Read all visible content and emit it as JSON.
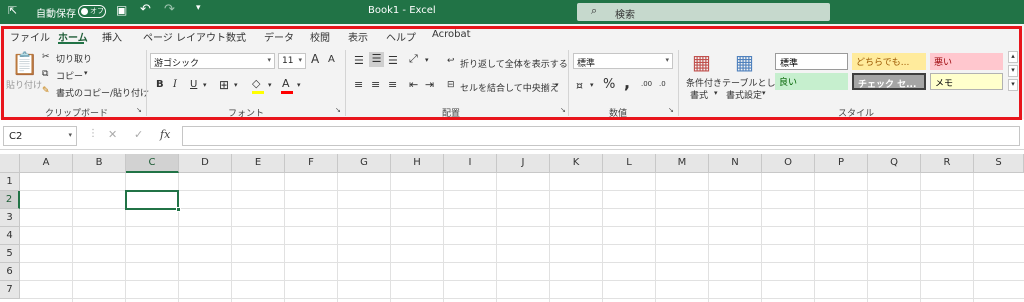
{
  "titlebar": {
    "autosave_label": "自動保存",
    "autosave_state": "オフ",
    "title": "Book1  -  Excel",
    "search_placeholder": "検索",
    "undo_icon": "undo-icon",
    "redo_icon": "redo-icon",
    "save_icon": "save-icon"
  },
  "tabs": [
    "ファイル",
    "ホーム",
    "挿入",
    "ページ レイアウト",
    "数式",
    "データ",
    "校閲",
    "表示",
    "ヘルプ",
    "Acrobat"
  ],
  "active_tab": "ホーム",
  "ribbon": {
    "clipboard": {
      "paste": "貼り付け",
      "cut": "切り取り",
      "copy": "コピー",
      "format_painter": "書式のコピー/貼り付け",
      "label": "クリップボード"
    },
    "font": {
      "font_name": "游ゴシック",
      "font_size": "11",
      "grow": "A",
      "shrink": "A",
      "bold": "B",
      "italic": "I",
      "underline": "U",
      "font_color_glyph": "A",
      "label": "フォント",
      "fill_color": "#ffff00",
      "font_color": "#ff0000"
    },
    "alignment": {
      "wrap_text": "折り返して全体を表示する",
      "merge_center": "セルを結合して中央揃え",
      "label": "配置"
    },
    "number": {
      "format": "標準",
      "percent": "%",
      "comma": ",",
      "inc_decimal": ".00",
      "dec_decimal": ".0",
      "label": "数値"
    },
    "styles": {
      "conditional_formatting": [
        "条件付き",
        "書式"
      ],
      "format_as_table": [
        "テーブルとして",
        "書式設定"
      ],
      "cells": [
        {
          "text": "標準",
          "bg": "#ffffff",
          "fg": "#000000"
        },
        {
          "text": "どちらでも...",
          "bg": "#ffeb9c",
          "fg": "#9c5700"
        },
        {
          "text": "悪い",
          "bg": "#ffc7ce",
          "fg": "#9c0006"
        },
        {
          "text": "良い",
          "bg": "#c6efce",
          "fg": "#006100"
        },
        {
          "text": "チェック セ...",
          "bg": "#a5a5a5",
          "fg": "#ffffff"
        },
        {
          "text": "メモ",
          "bg": "#ffffcc",
          "fg": "#000000"
        }
      ],
      "label": "スタイル"
    }
  },
  "formula_bar": {
    "name_box": "C2",
    "cancel": "✕",
    "enter": "✓",
    "fx": "fx",
    "value": ""
  },
  "grid": {
    "columns": [
      "A",
      "B",
      "C",
      "D",
      "E",
      "F",
      "G",
      "H",
      "I",
      "J",
      "K",
      "L",
      "M",
      "N",
      "O",
      "P",
      "Q",
      "R",
      "S"
    ],
    "rows": [
      "1",
      "2",
      "3",
      "4",
      "5",
      "6",
      "7"
    ],
    "selected_column": "C",
    "selected_row": "2"
  },
  "colors": {
    "accent": "#217346",
    "highlight_border": "#e8151b"
  }
}
